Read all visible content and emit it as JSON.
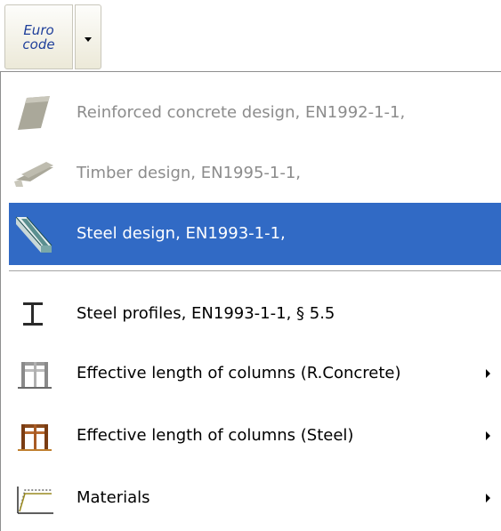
{
  "toolbar": {
    "button_line1": "Euro",
    "button_line2": "code"
  },
  "menu": {
    "items": [
      {
        "label": "Reinforced concrete design,  EN1992-1-1,",
        "icon": "concrete-slab-icon",
        "state": "disabled"
      },
      {
        "label": "Timber design,  EN1995-1-1,",
        "icon": "timber-beam-icon",
        "state": "disabled"
      },
      {
        "label": "Steel design,  EN1993-1-1,",
        "icon": "steel-beam-icon",
        "state": "selected"
      },
      {
        "label": "Steel profiles,  EN1993-1-1, § 5.5",
        "icon": "i-profile-icon",
        "state": "normal"
      },
      {
        "label": "Effective length of columns (R.Concrete)",
        "icon": "concrete-frame-icon",
        "state": "normal",
        "submenu": true
      },
      {
        "label": "Effective length of columns (Steel)",
        "icon": "steel-frame-icon",
        "state": "normal",
        "submenu": true
      },
      {
        "label": "Materials",
        "icon": "material-curve-icon",
        "state": "normal",
        "submenu": true
      }
    ]
  },
  "colors": {
    "selection": "#316ac5",
    "disabled_text": "#8c8c8c",
    "button_text": "#1f3f9a"
  }
}
